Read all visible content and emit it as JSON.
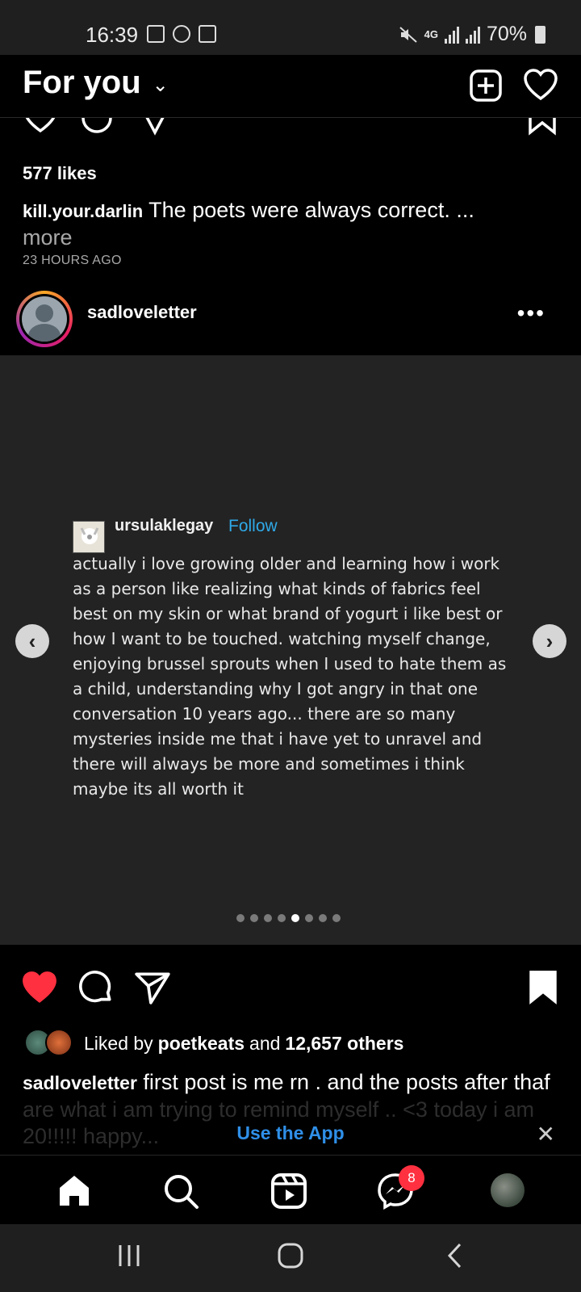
{
  "status_bar": {
    "time": "16:39",
    "network": "4G",
    "battery": "70%"
  },
  "header": {
    "title": "For you",
    "new_post_icon": "plus-square-icon",
    "activity_icon": "heart-icon"
  },
  "previous_post": {
    "likes": "577 likes",
    "username": "kill.your.darlin",
    "caption": "The poets were always correct. ...",
    "more": "more",
    "time_ago": "23 HOURS AGO"
  },
  "post": {
    "username": "sadloveletter",
    "options_label": "•••",
    "quote": {
      "user": "ursulaklegay",
      "follow": "Follow",
      "text": "actually i love growing older and learning how i work as a person like realizing what kinds of fabrics feel best on my skin or what brand of yogurt i like best or how I want to be touched. watching myself change, enjoying brussel sprouts when I used to hate them as a child, understanding why I got angry in that one conversation 10 years ago... there are so many mysteries inside me that i have yet to unravel and there will always be more and sometimes i think maybe its all worth it"
    },
    "carousel": {
      "total": 8,
      "active_index": 4
    },
    "liked_by_prefix": "Liked by",
    "liked_by_user": "poetkeats",
    "liked_by_and": "and",
    "liked_by_others": "12,657 others",
    "caption_user": "sadloveletter",
    "caption_line1": "first post is me rn . and the posts after thaf",
    "caption_faded": "are what i am trying to remind myself .. <3 today i am 20!!!!! happy..."
  },
  "banner": {
    "label": "Use the App",
    "close": "✕"
  },
  "bottom_nav": {
    "items": [
      "home-icon",
      "search-icon",
      "reels-icon",
      "messenger-icon",
      "profile-avatar"
    ],
    "messenger_badge": "8"
  },
  "colors": {
    "like_red": "#ff3040",
    "link_blue": "#2fa9e8",
    "banner_blue": "#2f8fe8"
  }
}
